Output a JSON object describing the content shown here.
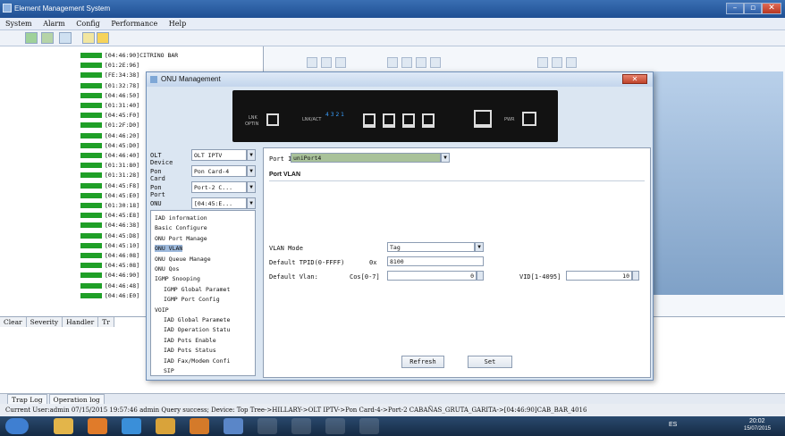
{
  "window": {
    "title": "Element Management System",
    "btn_min": "–",
    "btn_max": "▫",
    "btn_close": "✕"
  },
  "menu": [
    "System",
    "Alarm",
    "Config",
    "Performance",
    "Help"
  ],
  "alarm_rows": [
    "[04:46:90]CITRINO BAR",
    "[01:2E:96]",
    "[FE:34:38]",
    "[01:32:78]",
    "[04:46:50]",
    "[01:31:40]",
    "[04:45:F0]",
    "[01:2F:D0]",
    "[04:46:20]",
    "[04:45:D0]",
    "[04:46:40]",
    "[01:31:80]",
    "[01:31:28]",
    "[04:45:F8]",
    "[04:45:E0]",
    "[01:30:18]",
    "[04:45:E8]",
    "[04:46:38]",
    "[04:45:D8]",
    "[04:45:10]",
    "[04:46:08]",
    "[04:45:08]",
    "[04:46:90]",
    "[04:46:48]",
    "[04:46:E0]"
  ],
  "lower_headers": [
    "Clear",
    "Severity",
    "Handler",
    "Tr"
  ],
  "tabs": [
    "Trap Log",
    "Operation log"
  ],
  "status": "Current User:admin   07/15/2015 19:57:46  admin  Query  success; Device: Top Tree->HILLARY->OLT IPTV->Pon Card-4->Port-2 CABAÑAS_GRUTA_GARITA->[04:46:90]CAB_BAR_4016",
  "onu": {
    "title": "ONU Management",
    "device_labels": {
      "lnk": "LNK",
      "optin": "OPTIN",
      "lnkact": "LNK/ACT",
      "pwr": "PWR",
      "nums": "4 3 2 1"
    },
    "selectors": [
      {
        "label": "OLT Device",
        "value": "OLT IPTV"
      },
      {
        "label": "Pon Card",
        "value": "Pon Card-4"
      },
      {
        "label": "Pon Port",
        "value": "Port-2 C..."
      },
      {
        "label": "ONU",
        "value": "[04:45:E..."
      }
    ],
    "tree": [
      "IAD information",
      "Basic Configure",
      "ONU Port Manage",
      "ONU VLAN",
      "ONU Queue Manage",
      "ONU Qos",
      "IGMP Snooping",
      "IGMP Global Paramet",
      "IGMP Port Config",
      "VOIP",
      "IAD Global Paramete",
      "IAD Operation Statu",
      "IAD Pots Enable",
      "IAD Pots Status",
      "IAD Fax/Modem Confi",
      "SIP"
    ],
    "port_id_label": "Port ID",
    "port_id_value": "uniPort4",
    "section": "Port VLAN",
    "vlan_mode_label": "VLAN Mode",
    "vlan_mode_value": "Tag",
    "tpid_label": "Default TPID(0-FFFF)",
    "tpid_prefix": "0x",
    "tpid_value": "8100",
    "vlan_label": "Default Vlan:",
    "cos_label": "Cos[0-7]",
    "cos_value": "0",
    "vid_label": "VID[1-4095]",
    "vid_value": "10",
    "refresh": "Refresh",
    "set": "Set"
  },
  "tray": {
    "lang": "ES",
    "time": "20:02",
    "date": "15/07/2015"
  }
}
